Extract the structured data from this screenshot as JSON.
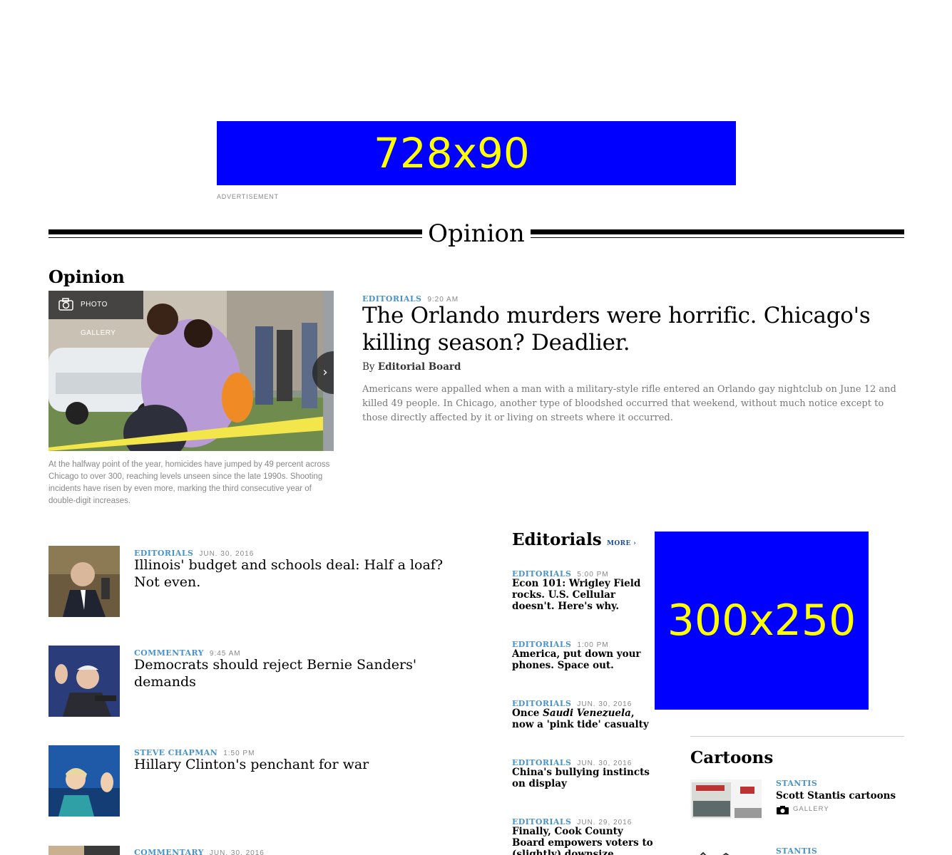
{
  "ads": {
    "leaderboard_text": "728x90",
    "leaderboard_label": "ADVERTISEMENT",
    "rectangle_text": "300x250",
    "leaderboard_color": "#0000ff",
    "ad_text_color": "#ffff00"
  },
  "section_title": "Opinion",
  "opinion": {
    "heading": "Opinion",
    "gallery_badge": "PHOTO GALLERY",
    "caption": "At the halfway point of the year, homicides have jumped by 49 percent across Chicago to over 300, reaching levels unseen since the late 1990s. Shooting incidents have risen by even more, marking the third consecutive year of double-digit increases.",
    "lead": {
      "kicker": "EDITORIALS",
      "time": "9:20 AM",
      "headline": "The Orlando murders were horrific. Chicago's killing season? Deadlier.",
      "byline_prefix": "By",
      "byline_author": "Editorial Board",
      "summary": "Americans were appalled when a man with a military-style rifle entered an Orlando gay nightclub on June 12 and killed 49 people. In Chicago, another type of bloodshed occurred that weekend, without much notice except to those directly affected by it or living on streets where it occurred."
    },
    "stories": [
      {
        "kicker": "EDITORIALS",
        "time": "JUN. 30, 2016",
        "headline": "Illinois' budget and schools deal: Half a loaf? Not even."
      },
      {
        "kicker": "COMMENTARY",
        "time": "9:45 AM",
        "headline": "Democrats should reject Bernie Sanders' demands"
      },
      {
        "kicker": "STEVE CHAPMAN",
        "time": "1:50 PM",
        "headline": "Hillary Clinton's penchant for war"
      },
      {
        "kicker": "COMMENTARY",
        "time": "JUN. 30, 2016",
        "headline": ""
      }
    ]
  },
  "editorials": {
    "heading": "Editorials",
    "more": "MORE ›",
    "items": [
      {
        "kicker": "EDITORIALS",
        "time": "5:00 PM",
        "headline": "Econ 101: Wrigley Field rocks. U.S. Cellular doesn't. Here's why."
      },
      {
        "kicker": "EDITORIALS",
        "time": "1:00 PM",
        "headline": "America, put down your phones. Space out."
      },
      {
        "kicker": "EDITORIALS",
        "time": "JUN. 30, 2016",
        "headline_pre": "Once ",
        "headline_em": "Saudi Venezuela",
        "headline_post": ", now a 'pink tide' casualty"
      },
      {
        "kicker": "EDITORIALS",
        "time": "JUN. 30, 2016",
        "headline": "China's bullying instincts on display"
      },
      {
        "kicker": "EDITORIALS",
        "time": "JUN. 29, 2016",
        "headline": "Finally, Cook County Board empowers voters to (slightly) downsize"
      }
    ]
  },
  "cartoons": {
    "heading": "Cartoons",
    "items": [
      {
        "kicker": "STANTIS",
        "title": "Scott Stantis cartoons",
        "gallery": "GALLERY"
      },
      {
        "kicker": "STANTIS",
        "title": "",
        "gallery": ""
      }
    ]
  },
  "colors": {
    "kicker": "#4a93c7",
    "more_link": "#1a4f8b"
  },
  "icons": {
    "gallery": "camera-icon",
    "next": "chevron-right-icon",
    "small_gallery": "camera-icon"
  }
}
